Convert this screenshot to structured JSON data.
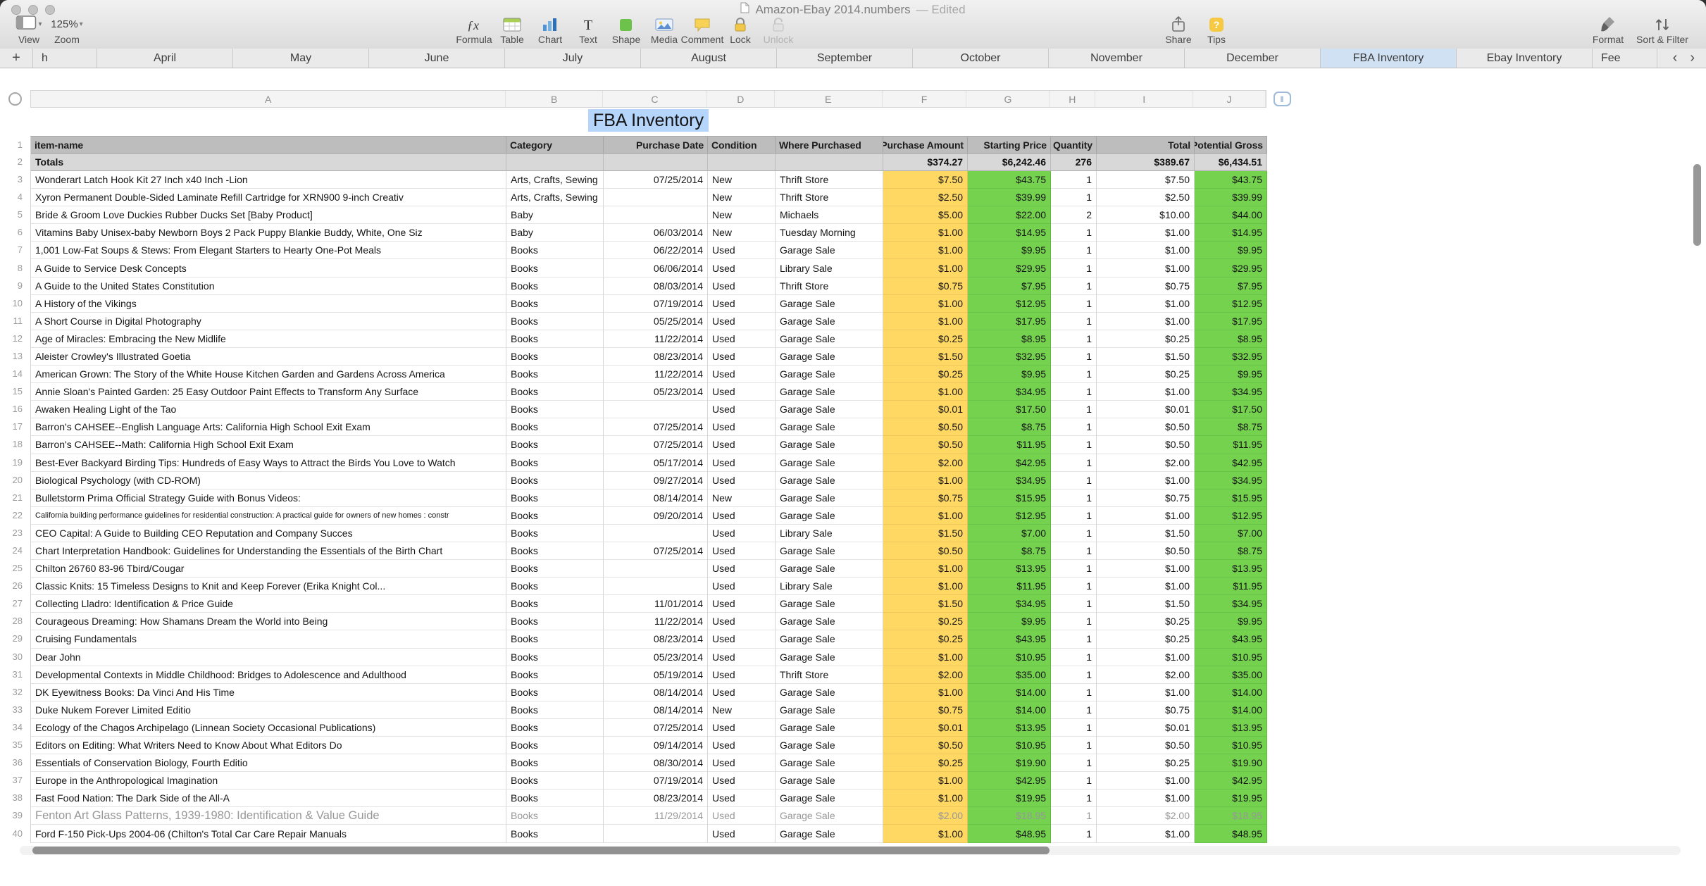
{
  "window": {
    "title": "Amazon-Ebay 2014.numbers",
    "edited": "— Edited"
  },
  "toolbar": {
    "view": {
      "label": "View"
    },
    "zoom": {
      "label": "Zoom",
      "value": "125%"
    },
    "insert_tools": [
      {
        "label": "Formula",
        "icon": "formula"
      },
      {
        "label": "Table",
        "icon": "table"
      },
      {
        "label": "Chart",
        "icon": "chart"
      },
      {
        "label": "Text",
        "icon": "text"
      },
      {
        "label": "Shape",
        "icon": "shape"
      },
      {
        "label": "Media",
        "icon": "media"
      },
      {
        "label": "Comment",
        "icon": "comment"
      },
      {
        "label": "Lock",
        "icon": "lock"
      },
      {
        "label": "Unlock",
        "icon": "unlock",
        "disabled": true
      }
    ],
    "share_tools": [
      {
        "label": "Share",
        "icon": "share"
      },
      {
        "label": "Tips",
        "icon": "tips"
      }
    ],
    "right_tools": [
      {
        "label": "Format",
        "icon": "format"
      },
      {
        "label": "Sort & Filter",
        "icon": "sort-filter"
      }
    ]
  },
  "tabs": {
    "add_label": "+",
    "scroll_left": "‹",
    "scroll_right": "›",
    "items": [
      {
        "label": "h",
        "partial": "left"
      },
      {
        "label": "April"
      },
      {
        "label": "May"
      },
      {
        "label": "June"
      },
      {
        "label": "July"
      },
      {
        "label": "August"
      },
      {
        "label": "September"
      },
      {
        "label": "October"
      },
      {
        "label": "November"
      },
      {
        "label": "December"
      },
      {
        "label": "FBA Inventory",
        "selected": true
      },
      {
        "label": "Ebay Inventory"
      },
      {
        "label": "Fee",
        "partial": "right"
      }
    ]
  },
  "sheet": {
    "title": "FBA Inventory",
    "column_refs": [
      "A",
      "B",
      "C",
      "D",
      "E",
      "F",
      "G",
      "H",
      "I",
      "J"
    ],
    "table": {
      "columns": [
        "item-name",
        "Category",
        "Purchase Date",
        "Condition",
        "Where Purchased",
        "Purchase Amount",
        "Starting Price",
        "Quantity",
        "Total",
        "Potential Gross"
      ],
      "totals": [
        "Totals",
        "",
        "",
        "",
        "",
        "$374.27",
        "$6,242.46",
        "276",
        "$389.67",
        "$6,434.51"
      ],
      "muted_rows": [
        39
      ],
      "rows": [
        [
          "Wonderart Latch Hook Kit 27 Inch x40 Inch -Lion",
          "Arts, Crafts, Sewing",
          "07/25/2014",
          "New",
          "Thrift Store",
          "$7.50",
          "$43.75",
          "1",
          "$7.50",
          "$43.75"
        ],
        [
          "Xyron Permanent Double-Sided Laminate Refill Cartridge for XRN900 9-inch Creativ",
          "Arts, Crafts, Sewing",
          "",
          "New",
          "Thrift Store",
          "$2.50",
          "$39.99",
          "1",
          "$2.50",
          "$39.99"
        ],
        [
          "Bride & Groom Love Duckies Rubber Ducks Set [Baby Product]",
          "Baby",
          "",
          "New",
          "Michaels",
          "$5.00",
          "$22.00",
          "2",
          "$10.00",
          "$44.00"
        ],
        [
          "Vitamins Baby Unisex-baby Newborn Boys 2 Pack Puppy Blankie Buddy, White, One Siz",
          "Baby",
          "06/03/2014",
          "New",
          "Tuesday Morning",
          "$1.00",
          "$14.95",
          "1",
          "$1.00",
          "$14.95"
        ],
        [
          "1,001 Low-Fat Soups & Stews: From Elegant Starters to Hearty One-Pot Meals",
          "Books",
          "06/22/2014",
          "Used",
          "Garage Sale",
          "$1.00",
          "$9.95",
          "1",
          "$1.00",
          "$9.95"
        ],
        [
          "A Guide to Service Desk Concepts",
          "Books",
          "06/06/2014",
          "Used",
          "Library Sale",
          "$1.00",
          "$29.95",
          "1",
          "$1.00",
          "$29.95"
        ],
        [
          "A Guide to the United States Constitution",
          "Books",
          "08/03/2014",
          "Used",
          "Thrift Store",
          "$0.75",
          "$7.95",
          "1",
          "$0.75",
          "$7.95"
        ],
        [
          "A History of the Vikings",
          "Books",
          "07/19/2014",
          "Used",
          "Garage Sale",
          "$1.00",
          "$12.95",
          "1",
          "$1.00",
          "$12.95"
        ],
        [
          "A Short Course in Digital Photography",
          "Books",
          "05/25/2014",
          "Used",
          "Garage Sale",
          "$1.00",
          "$17.95",
          "1",
          "$1.00",
          "$17.95"
        ],
        [
          "Age of Miracles: Embracing the New Midlife",
          "Books",
          "11/22/2014",
          "Used",
          "Garage Sale",
          "$0.25",
          "$8.95",
          "1",
          "$0.25",
          "$8.95"
        ],
        [
          "Aleister Crowley's Illustrated Goetia",
          "Books",
          "08/23/2014",
          "Used",
          "Garage Sale",
          "$1.50",
          "$32.95",
          "1",
          "$1.50",
          "$32.95"
        ],
        [
          "American Grown: The Story of the White House Kitchen Garden and Gardens Across America",
          "Books",
          "11/22/2014",
          "Used",
          "Garage Sale",
          "$0.25",
          "$9.95",
          "1",
          "$0.25",
          "$9.95"
        ],
        [
          "Annie Sloan's Painted Garden: 25 Easy Outdoor Paint Effects to Transform Any Surface",
          "Books",
          "05/23/2014",
          "Used",
          "Garage Sale",
          "$1.00",
          "$34.95",
          "1",
          "$1.00",
          "$34.95"
        ],
        [
          "Awaken Healing Light of the Tao",
          "Books",
          "",
          "Used",
          "Garage Sale",
          "$0.01",
          "$17.50",
          "1",
          "$0.01",
          "$17.50"
        ],
        [
          "Barron's CAHSEE--English Language Arts: California High School Exit Exam",
          "Books",
          "07/25/2014",
          "Used",
          "Garage Sale",
          "$0.50",
          "$8.75",
          "1",
          "$0.50",
          "$8.75"
        ],
        [
          "Barron's CAHSEE--Math: California High School Exit Exam",
          "Books",
          "07/25/2014",
          "Used",
          "Garage Sale",
          "$0.50",
          "$11.95",
          "1",
          "$0.50",
          "$11.95"
        ],
        [
          "Best-Ever Backyard Birding Tips: Hundreds of Easy Ways to Attract the Birds You Love to Watch",
          "Books",
          "05/17/2014",
          "Used",
          "Garage Sale",
          "$2.00",
          "$42.95",
          "1",
          "$2.00",
          "$42.95"
        ],
        [
          "Biological Psychology (with CD-ROM)",
          "Books",
          "09/27/2014",
          "Used",
          "Garage Sale",
          "$1.00",
          "$34.95",
          "1",
          "$1.00",
          "$34.95"
        ],
        [
          "Bulletstorm Prima Official Strategy Guide with Bonus Videos:",
          "Books",
          "08/14/2014",
          "New",
          "Garage Sale",
          "$0.75",
          "$15.95",
          "1",
          "$0.75",
          "$15.95"
        ],
        [
          "California building performance guidelines for residential construction: A practical guide for owners of new homes : constr",
          "Books",
          "09/20/2014",
          "Used",
          "Garage Sale",
          "$1.00",
          "$12.95",
          "1",
          "$1.00",
          "$12.95"
        ],
        [
          "CEO Capital: A Guide to Building CEO Reputation and Company Succes",
          "Books",
          "",
          "Used",
          "Library Sale",
          "$1.50",
          "$7.00",
          "1",
          "$1.50",
          "$7.00"
        ],
        [
          "Chart Interpretation Handbook: Guidelines for Understanding the Essentials of the Birth Chart",
          "Books",
          "07/25/2014",
          "Used",
          "Garage Sale",
          "$0.50",
          "$8.75",
          "1",
          "$0.50",
          "$8.75"
        ],
        [
          "Chilton 26760 83-96 Tbird/Cougar",
          "Books",
          "",
          "Used",
          "Garage Sale",
          "$1.00",
          "$13.95",
          "1",
          "$1.00",
          "$13.95"
        ],
        [
          "Classic Knits: 15 Timeless Designs to Knit and Keep Forever (Erika Knight Col...",
          "Books",
          "",
          "Used",
          "Library Sale",
          "$1.00",
          "$11.95",
          "1",
          "$1.00",
          "$11.95"
        ],
        [
          "Collecting Lladro: Identification & Price Guide",
          "Books",
          "11/01/2014",
          "Used",
          "Garage Sale",
          "$1.50",
          "$34.95",
          "1",
          "$1.50",
          "$34.95"
        ],
        [
          "Courageous Dreaming: How Shamans Dream the World into Being",
          "Books",
          "11/22/2014",
          "Used",
          "Garage Sale",
          "$0.25",
          "$9.95",
          "1",
          "$0.25",
          "$9.95"
        ],
        [
          "Cruising Fundamentals",
          "Books",
          "08/23/2014",
          "Used",
          "Garage Sale",
          "$0.25",
          "$43.95",
          "1",
          "$0.25",
          "$43.95"
        ],
        [
          "Dear John",
          "Books",
          "05/23/2014",
          "Used",
          "Garage Sale",
          "$1.00",
          "$10.95",
          "1",
          "$1.00",
          "$10.95"
        ],
        [
          "Developmental Contexts in Middle Childhood: Bridges to Adolescence and Adulthood",
          "Books",
          "05/19/2014",
          "Used",
          "Thrift Store",
          "$2.00",
          "$35.00",
          "1",
          "$2.00",
          "$35.00"
        ],
        [
          "DK Eyewitness Books: Da Vinci And His Time",
          "Books",
          "08/14/2014",
          "Used",
          "Garage Sale",
          "$1.00",
          "$14.00",
          "1",
          "$1.00",
          "$14.00"
        ],
        [
          "Duke Nukem Forever Limited Editio",
          "Books",
          "08/14/2014",
          "New",
          "Garage Sale",
          "$0.75",
          "$14.00",
          "1",
          "$0.75",
          "$14.00"
        ],
        [
          "Ecology of the Chagos Archipelago (Linnean Society Occasional Publications)",
          "Books",
          "07/25/2014",
          "Used",
          "Garage Sale",
          "$0.01",
          "$13.95",
          "1",
          "$0.01",
          "$13.95"
        ],
        [
          "Editors on Editing: What Writers Need to Know About What Editors Do",
          "Books",
          "09/14/2014",
          "Used",
          "Garage Sale",
          "$0.50",
          "$10.95",
          "1",
          "$0.50",
          "$10.95"
        ],
        [
          "Essentials of Conservation Biology, Fourth Editio",
          "Books",
          "08/30/2014",
          "Used",
          "Garage Sale",
          "$0.25",
          "$19.90",
          "1",
          "$0.25",
          "$19.90"
        ],
        [
          "Europe in the Anthropological Imagination",
          "Books",
          "07/19/2014",
          "Used",
          "Garage Sale",
          "$1.00",
          "$42.95",
          "1",
          "$1.00",
          "$42.95"
        ],
        [
          "Fast Food Nation: The Dark Side of the All-A",
          "Books",
          "08/23/2014",
          "Used",
          "Garage Sale",
          "$1.00",
          "$19.95",
          "1",
          "$1.00",
          "$19.95"
        ],
        [
          "Fenton Art Glass Patterns, 1939-1980: Identification & Value Guide",
          "Books",
          "11/29/2014",
          "Used",
          "Garage Sale",
          "$2.00",
          "$18.95",
          "1",
          "$2.00",
          "$18.95"
        ],
        [
          "Ford F-150 Pick-Ups 2004-06 (Chilton's Total Car Care Repair Manuals",
          "Books",
          "",
          "Used",
          "Garage Sale",
          "$1.00",
          "$48.95",
          "1",
          "$1.00",
          "$48.95"
        ]
      ]
    }
  },
  "colors": {
    "cell_yellow": "#ffd763",
    "cell_green": "#74d24f",
    "header_gray": "#bdbdbd",
    "totals_gray": "#d8d8d8",
    "selected_tab_blue": "#cfe1f3",
    "title_selection_blue": "#b6d5fb"
  }
}
